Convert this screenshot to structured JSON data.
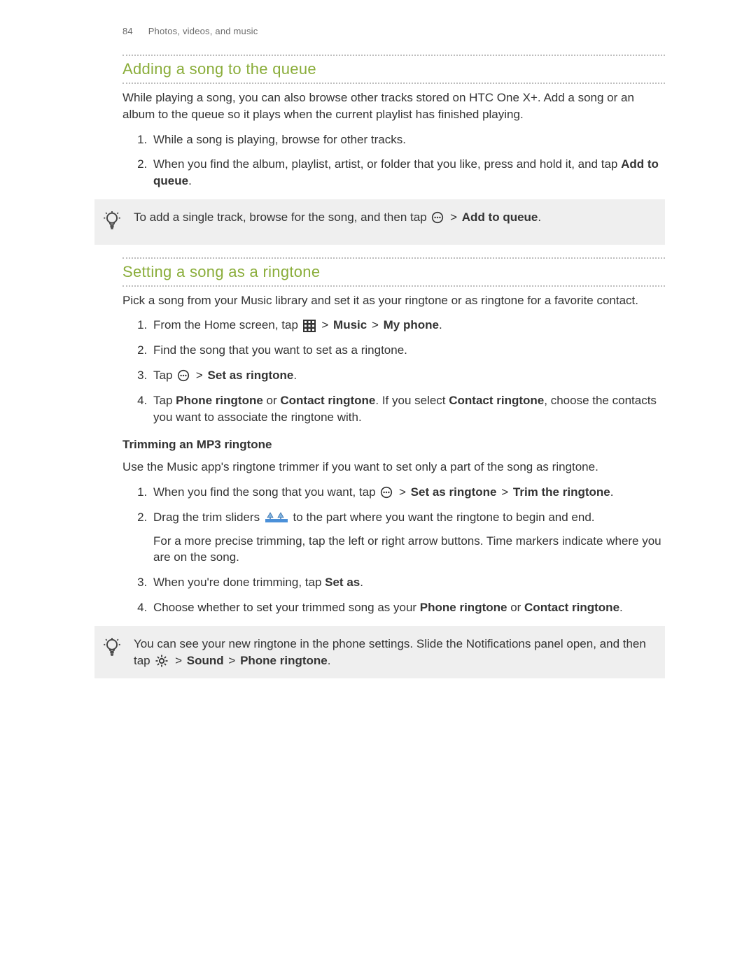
{
  "header": {
    "page_number": "84",
    "chapter": "Photos, videos, and music"
  },
  "section1": {
    "title": "Adding a song to the queue",
    "intro": "While playing a song, you can also browse other tracks stored on HTC One X+. Add a song or an album to the queue so it plays when the current playlist has finished playing.",
    "steps": {
      "s1": "While a song is playing, browse for other tracks.",
      "s2_pre": "When you find the album, playlist, artist, or folder that you like, press and hold it, and tap ",
      "s2_bold": "Add to queue",
      "s2_post": "."
    },
    "tip": {
      "pre": "To add a single track, browse for the song, and then tap ",
      "bold": "Add to queue",
      "post": "."
    }
  },
  "section2": {
    "title": "Setting a song as a ringtone",
    "intro": "Pick a song from your Music library and set it as your ringtone or as ringtone for a favorite contact.",
    "steps": {
      "s1_pre": "From the Home screen, tap ",
      "s1_music": "Music",
      "s1_myphone": "My phone",
      "s1_post": ".",
      "s2": "Find the song that you want to set as a ringtone.",
      "s3_pre": "Tap ",
      "s3_bold": "Set as ringtone",
      "s3_post": ".",
      "s4_pre": "Tap ",
      "s4_b1": "Phone ringtone",
      "s4_mid1": " or ",
      "s4_b2": "Contact ringtone",
      "s4_mid2": ". If you select ",
      "s4_b3": "Contact ringtone",
      "s4_post": ", choose the contacts you want to associate the ringtone with."
    },
    "sub": {
      "title": "Trimming an MP3 ringtone",
      "intro": "Use the Music app's ringtone trimmer if you want to set only a part of the song as ringtone.",
      "steps": {
        "s1_pre": "When you find the song that you want, tap ",
        "s1_b1": "Set as ringtone",
        "s1_b2": "Trim the ringtone",
        "s1_post": ".",
        "s2_pre": "Drag the trim sliders ",
        "s2_post": " to the part where you want the ringtone to begin and end.",
        "s2_extra": "For a more precise trimming, tap the left or right arrow buttons. Time markers indicate where you are on the song.",
        "s3_pre": "When you're done trimming, tap ",
        "s3_bold": "Set as",
        "s3_post": ".",
        "s4_pre": "Choose whether to set your trimmed song as your ",
        "s4_b1": "Phone ringtone",
        "s4_mid": " or ",
        "s4_b2": "Contact ringtone",
        "s4_post": "."
      }
    },
    "tip2": {
      "pre": "You can see your new ringtone in the phone settings. Slide the Notifications panel open, and then tap ",
      "b1": "Sound",
      "b2": "Phone ringtone",
      "post": "."
    }
  },
  "glyphs": {
    "gt": ">"
  }
}
